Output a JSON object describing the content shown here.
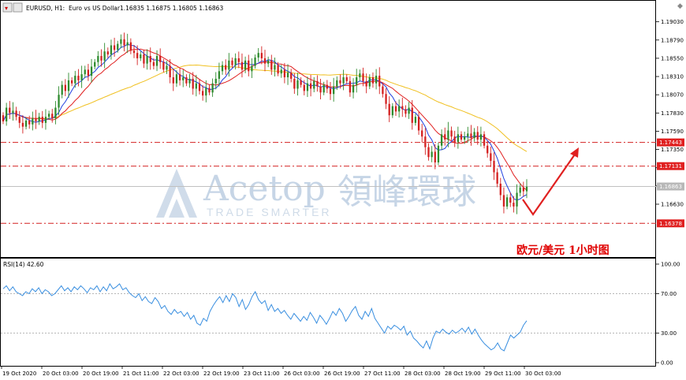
{
  "header": {
    "symbol": "EURUSD, H1:",
    "description": "Euro vs US Dollar",
    "ohlc": "1.16835 1.16875 1.16805 1.16863"
  },
  "watermark": {
    "brand": "Acetop",
    "chinese": "領峰環球",
    "tagline": "TRADE SMARTER"
  },
  "annotation": "欧元/美元  1小时图",
  "colors": {
    "bull": "#2e8b2e",
    "bear": "#d42020",
    "ma_fast": "#1f3fe0",
    "ma_mid": "#e02020",
    "ma_slow": "#f0c020",
    "rsi": "#3a8fe0",
    "level_line": "#d42020",
    "arrow": "#e02020",
    "label_bg": "#e02020",
    "price_label_bg": "#b8b8b8"
  },
  "chart_data": [
    {
      "type": "candlestick",
      "title": "EURUSD, H1",
      "y_ticks": [
        "1.19030",
        "1.18790",
        "1.18550",
        "1.18310",
        "1.18070",
        "1.17830",
        "1.17590",
        "1.17350",
        "1.17110",
        "1.16870",
        "1.16630"
      ],
      "ylim": [
        1.1635,
        1.1913
      ],
      "horizontal_levels": [
        "1.17443",
        "1.17131",
        "1.16378"
      ],
      "current_price": "1.16863",
      "x_ticks": [
        "19 Oct 2020",
        "20 Oct 03:00",
        "20 Oct 19:00",
        "21 Oct 11:00",
        "22 Oct 03:00",
        "22 Oct 19:00",
        "23 Oct 11:00",
        "26 Oct 03:00",
        "26 Oct 19:00",
        "27 Oct 11:00",
        "28 Oct 03:00",
        "28 Oct 19:00",
        "29 Oct 11:00",
        "30 Oct 03:00"
      ],
      "close": [
        1.1772,
        1.179,
        1.1783,
        1.1786,
        1.1778,
        1.177,
        1.1765,
        1.1773,
        1.1768,
        1.1776,
        1.1772,
        1.1778,
        1.177,
        1.1778,
        1.1782,
        1.1776,
        1.179,
        1.1807,
        1.182,
        1.1812,
        1.1826,
        1.1822,
        1.1832,
        1.1826,
        1.1834,
        1.184,
        1.1832,
        1.1844,
        1.185,
        1.1858,
        1.1852,
        1.1864,
        1.186,
        1.1872,
        1.1866,
        1.1874,
        1.188,
        1.1872,
        1.1876,
        1.1865,
        1.1862,
        1.1855,
        1.186,
        1.1848,
        1.1858,
        1.185,
        1.1845,
        1.1858,
        1.185,
        1.184,
        1.1845,
        1.183,
        1.1822,
        1.1834,
        1.1826,
        1.183,
        1.1822,
        1.1828,
        1.1815,
        1.1822,
        1.1812,
        1.1806,
        1.1816,
        1.181,
        1.1822,
        1.1828,
        1.1838,
        1.1846,
        1.184,
        1.1852,
        1.1846,
        1.1855,
        1.185,
        1.184,
        1.1852,
        1.1838,
        1.1845,
        1.1856,
        1.1862,
        1.1855,
        1.1848,
        1.1852,
        1.184,
        1.1846,
        1.1835,
        1.184,
        1.183,
        1.1836,
        1.1828,
        1.1815,
        1.1826,
        1.182,
        1.1812,
        1.1822,
        1.1815,
        1.1825,
        1.1818,
        1.181,
        1.182,
        1.1815,
        1.1808,
        1.1818,
        1.1826,
        1.1822,
        1.183,
        1.1825,
        1.181,
        1.182,
        1.183,
        1.1835,
        1.1825,
        1.1818,
        1.183,
        1.1822,
        1.1832,
        1.1818,
        1.1808,
        1.1795,
        1.178,
        1.1792,
        1.1785,
        1.1792,
        1.1788,
        1.1782,
        1.179,
        1.177,
        1.1778,
        1.176,
        1.1752,
        1.1738,
        1.1725,
        1.1732,
        1.1718,
        1.174,
        1.1755,
        1.1748,
        1.176,
        1.1752,
        1.1745,
        1.1755,
        1.1748,
        1.1752,
        1.1756,
        1.175,
        1.1758,
        1.1748,
        1.1755,
        1.174,
        1.173,
        1.172,
        1.1705,
        1.169,
        1.1675,
        1.166,
        1.1672,
        1.1665,
        1.166,
        1.1678,
        1.1685,
        1.168,
        1.1686
      ]
    },
    {
      "type": "line",
      "title": "RSI(14) 42.60",
      "y_ticks": [
        "100.00",
        "70.00",
        "30.00",
        "0.00"
      ],
      "ylim": [
        0,
        100
      ],
      "levels": [
        70,
        30
      ],
      "values": [
        75,
        78,
        73,
        77,
        72,
        70,
        68,
        72,
        70,
        75,
        72,
        76,
        70,
        74,
        72,
        68,
        70,
        74,
        78,
        73,
        76,
        72,
        77,
        74,
        78,
        75,
        71,
        76,
        74,
        78,
        72,
        77,
        73,
        80,
        75,
        77,
        80,
        74,
        76,
        71,
        68,
        66,
        70,
        63,
        67,
        62,
        60,
        66,
        62,
        55,
        58,
        52,
        49,
        54,
        50,
        52,
        47,
        51,
        44,
        48,
        40,
        38,
        45,
        42,
        52,
        58,
        63,
        67,
        61,
        68,
        62,
        70,
        66,
        57,
        64,
        54,
        59,
        67,
        72,
        64,
        60,
        63,
        53,
        59,
        52,
        55,
        50,
        53,
        48,
        44,
        50,
        46,
        42,
        47,
        43,
        51,
        46,
        40,
        48,
        44,
        39,
        45,
        52,
        48,
        55,
        50,
        42,
        47,
        53,
        57,
        48,
        44,
        52,
        47,
        55,
        45,
        40,
        35,
        30,
        37,
        34,
        38,
        36,
        33,
        37,
        28,
        32,
        25,
        22,
        18,
        15,
        22,
        14,
        25,
        32,
        30,
        34,
        31,
        29,
        33,
        30,
        32,
        35,
        31,
        36,
        29,
        34,
        28,
        23,
        19,
        16,
        13,
        15,
        20,
        14,
        12,
        20,
        28,
        25,
        28,
        31,
        38,
        42.6
      ]
    }
  ]
}
